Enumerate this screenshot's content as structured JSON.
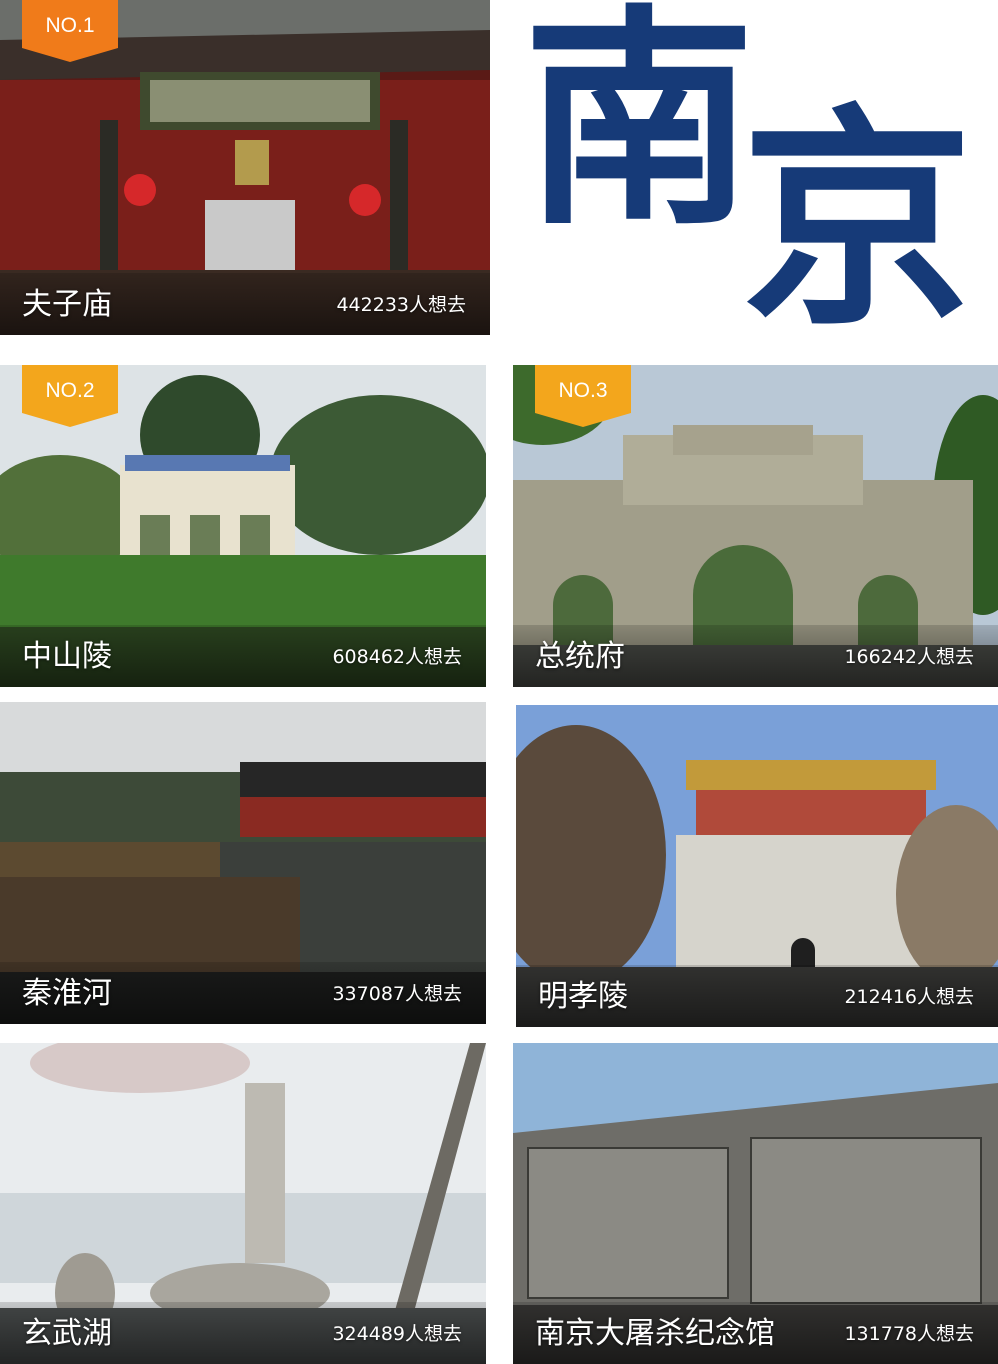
{
  "title": {
    "chars": [
      "南",
      "京"
    ]
  },
  "spots": [
    {
      "rank": "NO.1",
      "name": "夫子庙",
      "count": "442233人想去"
    },
    {
      "rank": "NO.2",
      "name": "中山陵",
      "count": "608462人想去"
    },
    {
      "rank": "NO.3",
      "name": "总统府",
      "count": "166242人想去"
    },
    {
      "name": "秦淮河",
      "count": "337087人想去"
    },
    {
      "name": "明孝陵",
      "count": "212416人想去"
    },
    {
      "name": "玄武湖",
      "count": "324489人想去"
    },
    {
      "name": "南京大屠杀纪念馆",
      "count": "131778人想去"
    }
  ],
  "colors": {
    "rank1": "#f07b1a",
    "rank2": "#f3a61c",
    "title": "#163a78"
  }
}
